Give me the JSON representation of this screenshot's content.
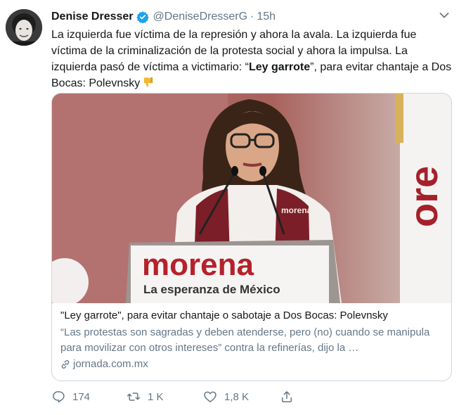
{
  "author": {
    "name": "Denise Dresser",
    "handle": "@DeniseDresserG",
    "separator": "·",
    "time": "15h"
  },
  "tweet": {
    "text_before": "La izquierda fue víctima de la represión y ahora la avala. La izquierda fue víctima de la criminalización de la protesta social y ahora la impulsa. La izquierda pasó de víctima a victimario: “",
    "text_bold": "Ley garrote",
    "text_after": "”, para evitar chantaje a Dos Bocas: Polevnsky"
  },
  "card": {
    "podium_brand": "morena",
    "podium_tagline": "La esperanza de México",
    "vest_brand": "morena",
    "flag_text": "ore",
    "title": "\"Ley garrote\", para evitar chantaje o sabotaje a Dos Bocas: Polevnsky",
    "description": "“Las protestas son sagradas y deben atenderse, pero (no) cuando se manipula para movilizar con otros intereses” contra la refinerías, dijo la …",
    "domain": "jornada.com.mx"
  },
  "actions": {
    "replies": "174",
    "retweets": "1 K",
    "likes": "1,8 K"
  },
  "icons": [
    "verified-badge",
    "caret-down",
    "thumbs-down-emoji",
    "link",
    "reply",
    "retweet",
    "like",
    "share"
  ],
  "colors": {
    "verified": "#1da1f2",
    "secondary_text": "#657786",
    "morena_red": "#b5212b",
    "border": "#ccd6dd"
  }
}
